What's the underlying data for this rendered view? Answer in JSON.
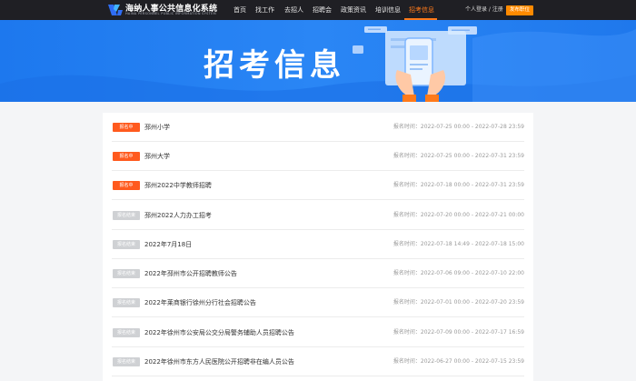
{
  "header": {
    "brand_title": "海纳人事公共信息化系统",
    "brand_subtitle": "HAINA PERSONNEL PUBLIC INFORMATION SYSTEM",
    "nav": [
      "首页",
      "找工作",
      "去招人",
      "招聘会",
      "政策资讯",
      "培训信息",
      "招考信息"
    ],
    "active_nav": "招考信息",
    "login_text": "个人登录 / 注册",
    "publish_label": "发布职位"
  },
  "banner": {
    "title": "招考信息"
  },
  "list": {
    "items": [
      {
        "status": "报名中",
        "status_type": "open",
        "title": "邳州小学",
        "time": "报名时间：2022-07-25 00:00 - 2022-07-28 23:59"
      },
      {
        "status": "报名中",
        "status_type": "open",
        "title": "邳州大学",
        "time": "报名时间：2022-07-25 00:00 - 2022-07-31 23:59"
      },
      {
        "status": "报名中",
        "status_type": "open",
        "title": "邳州2022中学教师招聘",
        "time": "报名时间：2022-07-18 00:00 - 2022-07-31 23:59"
      },
      {
        "status": "报名结束",
        "status_type": "closed",
        "title": "邳州2022人力办工招考",
        "time": "报名时间：2022-07-20 00:00 - 2022-07-21 00:00"
      },
      {
        "status": "报名结束",
        "status_type": "closed",
        "title": "2022年7月18日",
        "time": "报名时间：2022-07-18 14:49 - 2022-07-18 15:00"
      },
      {
        "status": "报名结束",
        "status_type": "closed",
        "title": "2022年邳州市公开招聘教师公告",
        "time": "报名时间：2022-07-06 09:00 - 2022-07-10 22:00"
      },
      {
        "status": "报名结束",
        "status_type": "closed",
        "title": "2022年莱商银行徐州分行社会招聘公告",
        "time": "报名时间：2022-07-01 00:00 - 2022-07-20 23:59"
      },
      {
        "status": "报名结束",
        "status_type": "closed",
        "title": "2022年徐州市公安局公交分局警务辅助人员招聘公告",
        "time": "报名时间：2022-07-09 00:00 - 2022-07-17 16:59"
      },
      {
        "status": "报名结束",
        "status_type": "closed",
        "title": "2022年徐州市东方人民医院公开招聘非在编人员公告",
        "time": "报名时间：2022-06-27 00:00 - 2022-07-15 23:59"
      }
    ]
  },
  "colors": {
    "accent": "#ff7a1a",
    "banner_blue": "#2a86f5",
    "open_badge": "#ff5a1e",
    "closed_badge": "#cfd1d4"
  }
}
